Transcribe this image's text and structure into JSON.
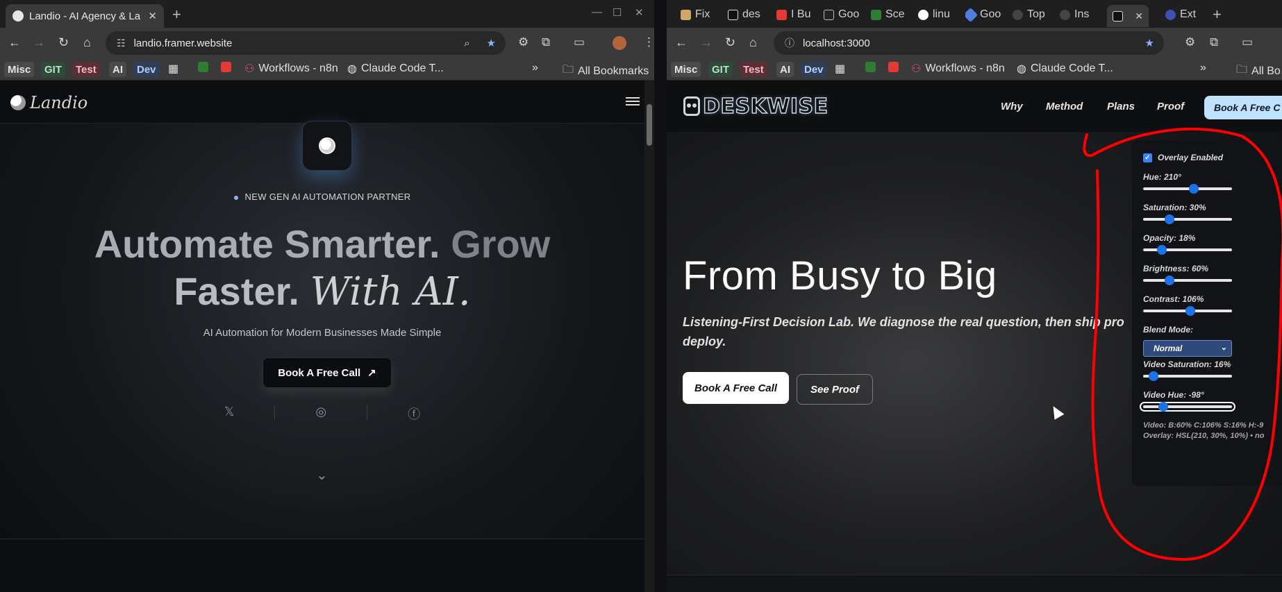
{
  "left_window": {
    "tab_title": "Landio - AI Agency & La",
    "url": "landio.framer.website",
    "bookmarks": [
      "Misc",
      "GIT",
      "Test",
      "AI",
      "Dev"
    ],
    "bookmark_links": [
      "Workflows - n8n",
      "Claude Code T...",
      "All Bookmarks"
    ],
    "page": {
      "brand": "Landio",
      "eyebrow": "NEW GEN AI AUTOMATION PARTNER",
      "headline_part1": "Automate Smarter.",
      "headline_part2": "Grow",
      "headline_part3": "Faster.",
      "headline_part4": "With AI.",
      "subheadline": "AI Automation for Modern Businesses Made Simple",
      "cta": "Book A Free Call",
      "social_icons": [
        "x-icon",
        "instagram-icon",
        "facebook-icon"
      ]
    }
  },
  "right_window": {
    "tabs": [
      "Fix",
      "des",
      "I Bu",
      "Goo",
      "Sce",
      "linu",
      "Goo",
      "Top",
      "Ins",
      "",
      "Ext"
    ],
    "url": "localhost:3000",
    "bookmarks": [
      "Misc",
      "GIT",
      "Test",
      "AI",
      "Dev"
    ],
    "bookmark_links": [
      "Workflows - n8n",
      "Claude Code T...",
      "All Bo"
    ],
    "page": {
      "brand": "DESKWISE",
      "nav": [
        "Why",
        "Method",
        "Plans",
        "Proof"
      ],
      "nav_cta": "Book A Free C",
      "headline": "From Busy to Big",
      "subheadline_line1": "Listening-First Decision Lab. We diagnose the real question, then ship pro",
      "subheadline_line2": "deploy.",
      "primary_button": "Book A Free Call",
      "secondary_button": "See Proof"
    },
    "overlay_panel": {
      "checkbox_label": "Overlay Enabled",
      "checkbox_checked": true,
      "sliders": [
        {
          "label": "Hue: 210°",
          "fraction": 0.57
        },
        {
          "label": "Saturation: 30%",
          "fraction": 0.3
        },
        {
          "label": "Opacity: 18%",
          "fraction": 0.21
        },
        {
          "label": "Brightness: 60%",
          "fraction": 0.3
        },
        {
          "label": "Contrast: 106%",
          "fraction": 0.53
        }
      ],
      "blend_label": "Blend Mode:",
      "blend_value": "Normal",
      "video_sliders": [
        {
          "label": "Video Saturation: 16%",
          "fraction": 0.12
        },
        {
          "label": "Video Hue: -98°",
          "fraction": 0.23
        }
      ],
      "readout_line1": "Video: B:60% C:106% S:16% H:-9",
      "readout_line2": "Overlay: HSL(210, 30%, 10%) • no"
    }
  },
  "colors": {
    "accent_blue": "#1a73e8",
    "annotation_red": "#ff0000",
    "deskwise_cta": "#bfe3ff"
  }
}
